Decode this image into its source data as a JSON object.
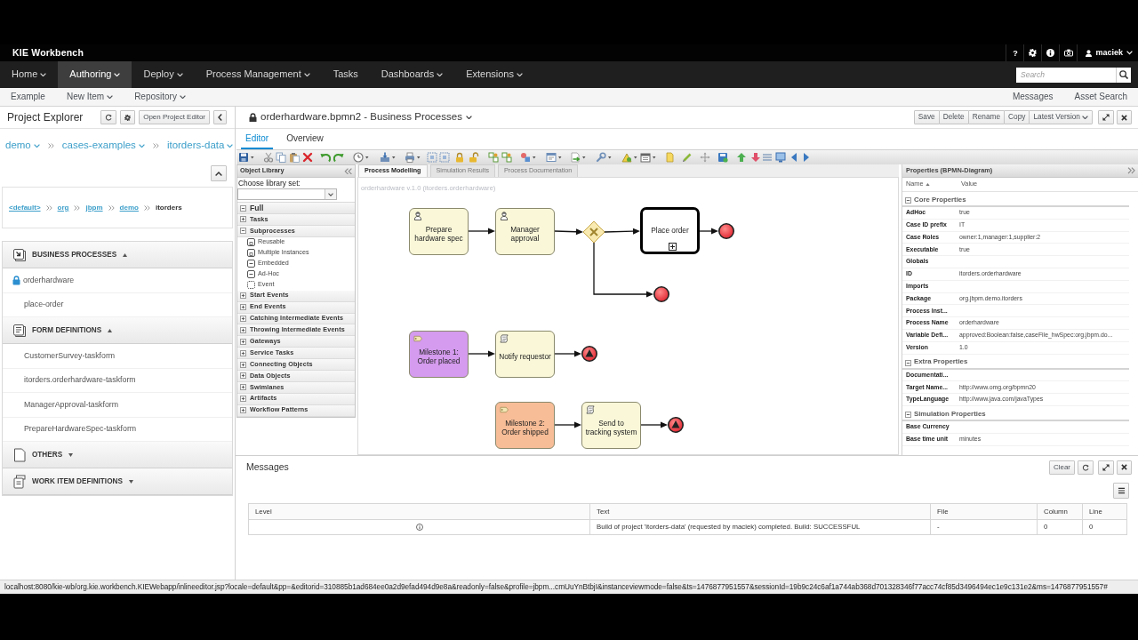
{
  "top_bar": {
    "brand": "KIE Workbench",
    "help": "?",
    "user": {
      "name": "maciek",
      "dropdown": true
    }
  },
  "nav": {
    "items": [
      {
        "label": "Home",
        "selected": false,
        "dropdown": true
      },
      {
        "label": "Authoring",
        "selected": true,
        "dropdown": true
      },
      {
        "label": "Deploy",
        "selected": false,
        "dropdown": true
      },
      {
        "label": "Process Management",
        "selected": false,
        "dropdown": true
      },
      {
        "label": "Tasks",
        "selected": false,
        "dropdown": false
      },
      {
        "label": "Dashboards",
        "selected": false,
        "dropdown": true
      },
      {
        "label": "Extensions",
        "selected": false,
        "dropdown": true
      }
    ],
    "search": {
      "placeholder": "Search"
    }
  },
  "sub_nav": {
    "left": [
      {
        "label": "Example",
        "dropdown": false
      },
      {
        "label": "New Item",
        "dropdown": true
      },
      {
        "label": "Repository",
        "dropdown": true
      }
    ],
    "right": [
      {
        "label": "Messages"
      },
      {
        "label": "Asset Search"
      }
    ]
  },
  "explorer": {
    "title": "Project Explorer",
    "open_editor_button": "Open Project Editor",
    "breadcrumb": [
      {
        "label": "demo",
        "dropdown": true
      },
      {
        "label": "cases-examples",
        "dropdown": true
      },
      {
        "label": "itorders-data",
        "dropdown": true
      }
    ],
    "package_path": [
      {
        "label": "<default>",
        "current": false
      },
      {
        "label": "org",
        "current": false
      },
      {
        "label": "jbpm",
        "current": false
      },
      {
        "label": "demo",
        "current": false
      },
      {
        "label": "itorders",
        "current": true
      }
    ],
    "sections": [
      {
        "kind": "process",
        "title": "BUSINESS PROCESSES",
        "expanded": true,
        "items": [
          {
            "label": "orderhardware",
            "locked": true
          },
          {
            "label": "place-order",
            "locked": false
          }
        ]
      },
      {
        "kind": "form",
        "title": "FORM DEFINITIONS",
        "expanded": true,
        "items": [
          {
            "label": "CustomerSurvey-taskform",
            "locked": false
          },
          {
            "label": "itorders.orderhardware-taskform",
            "locked": false
          },
          {
            "label": "ManagerApproval-taskform",
            "locked": false
          },
          {
            "label": "PrepareHardwareSpec-taskform",
            "locked": false
          }
        ]
      },
      {
        "kind": "other",
        "title": "OTHERS",
        "expanded": false
      },
      {
        "kind": "work_item",
        "title": "WORK ITEM DEFINITIONS",
        "expanded": false
      }
    ]
  },
  "editor": {
    "title": "orderhardware.bpmn2 - Business Processes",
    "locked": true,
    "dropdown": true,
    "actions": [
      {
        "label": "Save",
        "dropdown": false
      },
      {
        "label": "Delete",
        "dropdown": false
      },
      {
        "label": "Rename",
        "dropdown": false
      },
      {
        "label": "Copy",
        "dropdown": false
      },
      {
        "label": "Latest Version",
        "dropdown": true
      }
    ],
    "tabs": [
      {
        "label": "Editor",
        "selected": true
      },
      {
        "label": "Overview",
        "selected": false
      }
    ]
  },
  "object_library": {
    "title": "Object Library",
    "choose_label": "Choose library set:",
    "root": {
      "label": "Full",
      "expanded": true
    },
    "groups": [
      {
        "label": "Tasks",
        "expanded": false
      },
      {
        "label": "Subprocesses",
        "expanded": true,
        "children": [
          {
            "label": "Reusable",
            "kind": "reusable"
          },
          {
            "label": "Multiple Instances",
            "kind": "reusable"
          },
          {
            "label": "Embedded",
            "kind": "embedded"
          },
          {
            "label": "Ad-Hoc",
            "kind": "embedded"
          },
          {
            "label": "Event",
            "kind": "event"
          }
        ]
      },
      {
        "label": "Start Events",
        "expanded": false
      },
      {
        "label": "End Events",
        "expanded": false
      },
      {
        "label": "Catching Intermediate Events",
        "expanded": false
      },
      {
        "label": "Throwing Intermediate Events",
        "expanded": false
      },
      {
        "label": "Gateways",
        "expanded": false
      },
      {
        "label": "Service Tasks",
        "expanded": false
      },
      {
        "label": "Connecting Objects",
        "expanded": false
      },
      {
        "label": "Data Objects",
        "expanded": false
      },
      {
        "label": "Swimlanes",
        "expanded": false
      },
      {
        "label": "Artifacts",
        "expanded": false
      },
      {
        "label": "Workflow Patterns",
        "expanded": false
      }
    ]
  },
  "canvas": {
    "tabs": [
      {
        "label": "Process Modelling",
        "selected": true
      },
      {
        "label": "Simulation Results",
        "selected": false
      },
      {
        "label": "Process Documentation",
        "selected": false
      }
    ],
    "caption": "orderhardware v.1.0 (itorders.orderhardware)",
    "nodes": [
      {
        "kind": "user_task",
        "label": "Prepare hardware spec",
        "color": "#f9f7d8"
      },
      {
        "kind": "user_task",
        "label": "Manager approval",
        "color": "#f9f7d8"
      },
      {
        "kind": "gateway"
      },
      {
        "kind": "call_activity",
        "label": "Place order",
        "color": "#ffffff"
      },
      {
        "kind": "end_event"
      },
      {
        "kind": "end_event"
      },
      {
        "kind": "milestone",
        "label": "Milestone 1: Order placed",
        "color": "#d49bee"
      },
      {
        "kind": "script_task",
        "label": "Notify requestor",
        "color": "#f9f7d8"
      },
      {
        "kind": "end_escalation"
      },
      {
        "kind": "milestone",
        "label": "Milestone 2: Order shipped",
        "color": "#f7bd97"
      },
      {
        "kind": "script_task",
        "label": "Send to tracking system",
        "color": "#f9f7d8"
      },
      {
        "kind": "end_escalation"
      }
    ]
  },
  "properties": {
    "title": "Properties (BPMN-Diagram)",
    "columns": [
      {
        "label": "Name",
        "sorted": true
      },
      {
        "label": "Value",
        "sorted": false
      }
    ],
    "groups": [
      {
        "title": "Core Properties",
        "expanded": true,
        "rows": [
          {
            "name": "AdHoc",
            "value": "true"
          },
          {
            "name": "Case ID prefix",
            "value": "IT"
          },
          {
            "name": "Case Roles",
            "value": "owner:1,manager:1,supplier:2"
          },
          {
            "name": "Executable",
            "value": "true"
          },
          {
            "name": "Globals"
          },
          {
            "name": "ID",
            "value": "itorders.orderhardware"
          },
          {
            "name": "Imports"
          },
          {
            "name": "Package",
            "value": "org.jbpm.demo.itorders"
          },
          {
            "name": "Process Inst..."
          },
          {
            "name": "Process Name",
            "value": "orderhardware"
          },
          {
            "name": "Variable Defi...",
            "value": "approved:Boolean:false,caseFile_hwSpec:org.jbpm.do..."
          },
          {
            "name": "Version",
            "value": "1.0"
          }
        ]
      },
      {
        "title": "Extra Properties",
        "expanded": true,
        "rows": [
          {
            "name": "Documentati..."
          },
          {
            "name": "Target Name...",
            "value": "http://www.omg.org/bpmn20"
          },
          {
            "name": "TypeLanguage",
            "value": "http://www.java.com/javaTypes"
          }
        ]
      },
      {
        "title": "Simulation Properties",
        "expanded": true,
        "rows": [
          {
            "name": "Base Currency"
          },
          {
            "name": "Base time unit",
            "value": "minutes"
          }
        ]
      }
    ]
  },
  "messages": {
    "title": "Messages",
    "clear_button": "Clear",
    "columns": [
      "Level",
      "Text",
      "File",
      "Column",
      "Line"
    ],
    "rows": [
      {
        "kind": "info",
        "text": "Build of project 'itorders-data' (requested by maciek) completed. Build: SUCCESSFUL",
        "file": "-",
        "column": "0",
        "line": "0"
      }
    ]
  },
  "status_url": "localhost:8080/kie-wb/org.kie.workbench.KIEWebapp/inlineeditor.jsp?locale=default&pp=&editorid=310885b1ad684ee0a2d9efad494d9e8a&readonly=false&profile=jbpm...cmUuYnBtbjI&instanceviewmode=false&ts=1476877951557&sessionId=19b9c24c6af1a744ab368d701328346f77acc74cf85d3496494ec1e9c131e2&ms=1476877951557#"
}
